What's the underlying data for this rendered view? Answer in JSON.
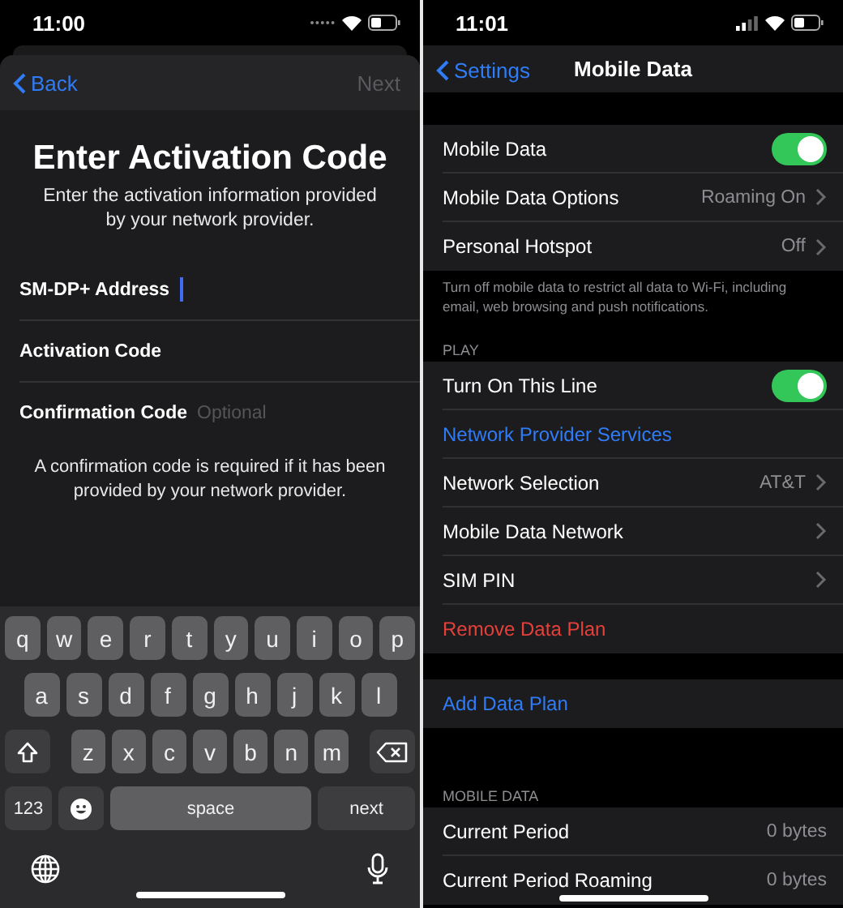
{
  "left": {
    "status_bar": {
      "time": "11:00"
    },
    "nav": {
      "back": "Back",
      "next": {
        "label": "Next",
        "disabled": true
      }
    },
    "title": "Enter Activation Code",
    "subtitle": "Enter the activation information provided by your network provider.",
    "fields": [
      {
        "label": "SM-DP+ Address",
        "focused": true
      },
      {
        "label": "Activation Code",
        "focused": false
      },
      {
        "label": "Confirmation Code",
        "placeholder": "Optional",
        "focused": false
      }
    ],
    "note": "A confirmation code is required if it has been provided by your network provider.",
    "keyboard": {
      "rows": [
        [
          "q",
          "w",
          "e",
          "r",
          "t",
          "y",
          "u",
          "i",
          "o",
          "p"
        ],
        [
          "a",
          "s",
          "d",
          "f",
          "g",
          "h",
          "j",
          "k",
          "l"
        ],
        [
          "z",
          "x",
          "c",
          "v",
          "b",
          "n",
          "m"
        ]
      ],
      "numbers_key": "123",
      "space_key": "space",
      "return_key": "next"
    }
  },
  "right": {
    "status_bar": {
      "time": "11:01"
    },
    "nav": {
      "back": "Settings",
      "title": "Mobile Data"
    },
    "sections": [
      {
        "rows": [
          {
            "kind": "toggle",
            "label": "Mobile Data",
            "on": true
          },
          {
            "kind": "detail",
            "label": "Mobile Data Options",
            "value": "Roaming On"
          },
          {
            "kind": "detail",
            "label": "Personal Hotspot",
            "value": "Off"
          }
        ],
        "footer": "Turn off mobile data to restrict all data to Wi-Fi, including email, web browsing and push notifications."
      },
      {
        "header": "PLAY",
        "rows": [
          {
            "kind": "toggle",
            "label": "Turn On This Line",
            "on": true
          },
          {
            "kind": "link",
            "label": "Network Provider Services"
          },
          {
            "kind": "detail",
            "label": "Network Selection",
            "value": "AT&T"
          },
          {
            "kind": "detail",
            "label": "Mobile Data Network"
          },
          {
            "kind": "detail",
            "label": "SIM PIN"
          },
          {
            "kind": "destructive",
            "label": "Remove Data Plan"
          }
        ]
      },
      {
        "rows": [
          {
            "kind": "link",
            "label": "Add Data Plan"
          }
        ]
      },
      {
        "header": "MOBILE DATA",
        "rows": [
          {
            "kind": "value",
            "label": "Current Period",
            "value": "0 bytes"
          },
          {
            "kind": "value",
            "label": "Current Period Roaming",
            "value": "0 bytes"
          }
        ]
      }
    ]
  }
}
